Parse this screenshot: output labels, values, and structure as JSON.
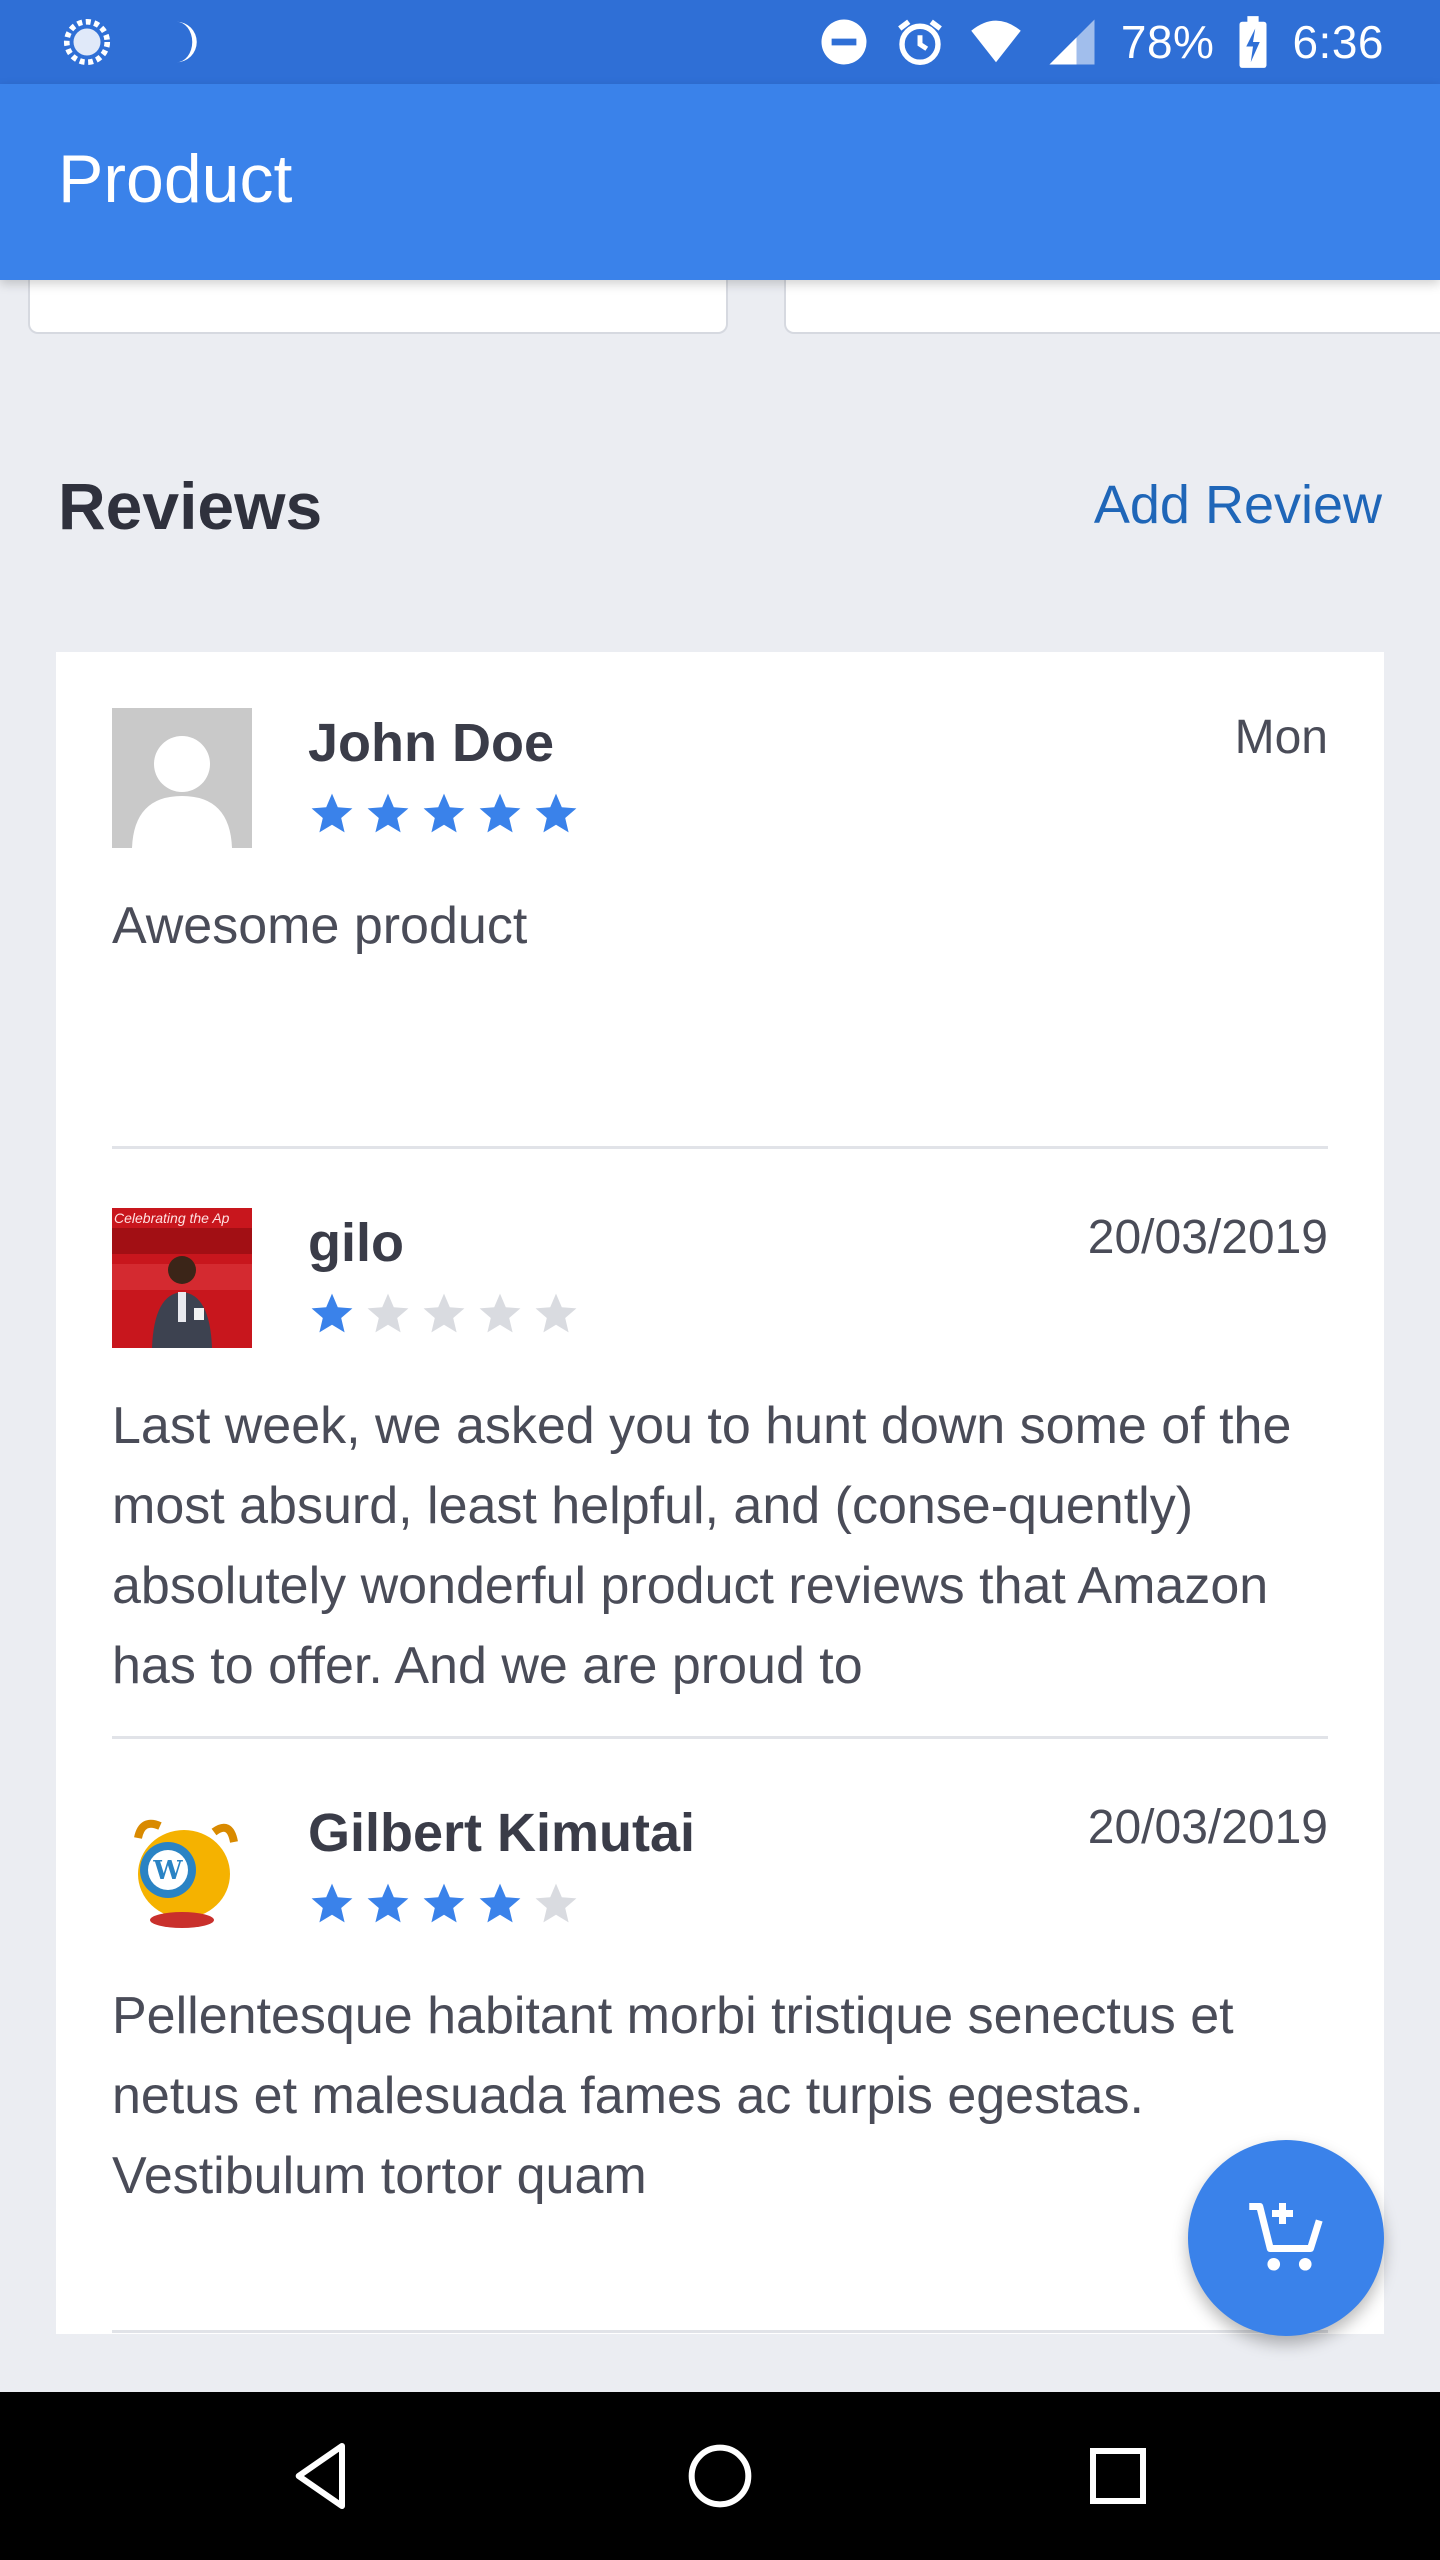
{
  "status_bar": {
    "battery": "78%",
    "time": "6:36",
    "icons": [
      "data-saver-icon",
      "moon-icon",
      "do-not-disturb-icon",
      "alarm-icon",
      "wifi-icon",
      "signal-icon",
      "battery-charging-icon"
    ]
  },
  "app_bar": {
    "title": "Product"
  },
  "reviews": {
    "title": "Reviews",
    "add_label": "Add Review",
    "items": [
      {
        "name": "John Doe",
        "date": "Mon",
        "rating": 5,
        "text": "Awesome product",
        "avatar": "placeholder-avatar-icon"
      },
      {
        "name": "gilo",
        "date": "20/03/2019",
        "rating": 1,
        "text": "Last week, we asked you to hunt down some of the most absurd, least helpful, and (conse-quently) absolutely wonderful product reviews that Amazon has to offer. And we are proud to",
        "avatar": "photo-avatar",
        "avatar_caption": "Celebrating the Ap"
      },
      {
        "name": "Gilbert Kimutai",
        "date": "20/03/2019",
        "rating": 4,
        "text": "Pellentesque habitant morbi tristique senectus et netus et malesuada fames ac turpis egestas. Vestibulum tortor quam",
        "avatar": "wapuu-avatar-icon"
      }
    ]
  },
  "fab": {
    "icon": "add-to-cart-icon"
  },
  "colors": {
    "status_bar": "#2f6fd6",
    "app_bar": "#3a82ea",
    "star_on": "#3a82ea",
    "star_off": "#d9dbe0",
    "link": "#1f66b8"
  }
}
